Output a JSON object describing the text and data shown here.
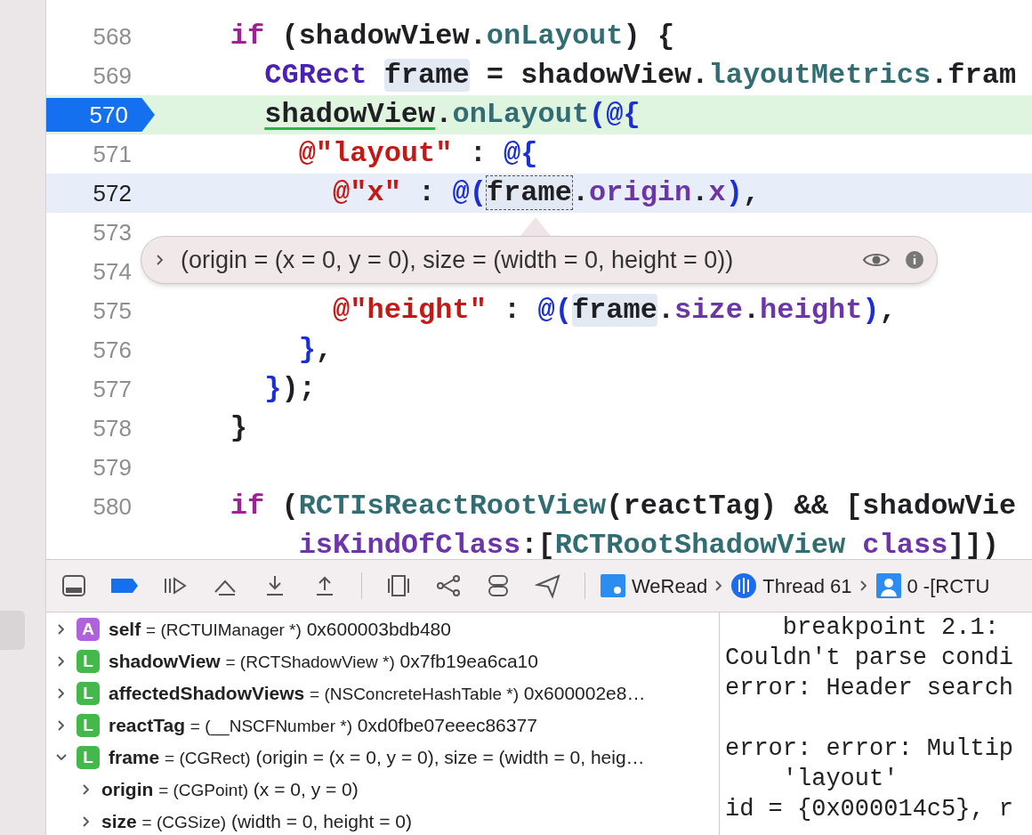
{
  "editor": {
    "lines": [
      {
        "number": "568",
        "kind": "plain",
        "tokens": [
          {
            "text": "    if",
            "kind": "keyword"
          },
          {
            "text": " (shadowView.",
            "kind": "plain"
          },
          {
            "text": "onLayout",
            "kind": "property"
          },
          {
            "text": ") {",
            "kind": "plain"
          }
        ]
      },
      {
        "number": "569",
        "kind": "plain",
        "tokens": [
          {
            "text": "      CGRect ",
            "kind": "type"
          },
          {
            "text": "frame",
            "kind": "reference"
          },
          {
            "text": " = shadowView.",
            "kind": "plain"
          },
          {
            "text": "layoutMetrics",
            "kind": "property"
          },
          {
            "text": ".fram",
            "kind": "plain"
          }
        ]
      },
      {
        "number": "570",
        "kind": "breakpoint",
        "tokens": [
          {
            "text": "      shadowView",
            "kind": "underline"
          },
          {
            "text": ".",
            "kind": "plain"
          },
          {
            "text": "onLayout",
            "kind": "property"
          },
          {
            "text": "(@{",
            "kind": "literal"
          }
        ]
      },
      {
        "number": "571",
        "kind": "plain",
        "tokens": [
          {
            "text": "        @\"layout\"",
            "kind": "string"
          },
          {
            "text": " : ",
            "kind": "plain"
          },
          {
            "text": "@{",
            "kind": "literal"
          }
        ]
      },
      {
        "number": "572",
        "kind": "cursor",
        "tokens": [
          {
            "text": "          @\"x\"",
            "kind": "string"
          },
          {
            "text": " : ",
            "kind": "plain"
          },
          {
            "text": "@(",
            "kind": "literal"
          },
          {
            "text": "frame",
            "kind": "hovered"
          },
          {
            "text": ".",
            "kind": "plain"
          },
          {
            "text": "origin",
            "kind": "method"
          },
          {
            "text": ".",
            "kind": "plain"
          },
          {
            "text": "x",
            "kind": "method"
          },
          {
            "text": ")",
            "kind": "literal"
          },
          {
            "text": ",",
            "kind": "plain"
          }
        ]
      },
      {
        "number": "573",
        "kind": "plain"
      },
      {
        "number": "574",
        "kind": "plain"
      },
      {
        "number": "575",
        "kind": "plain",
        "tokens": [
          {
            "text": "          @\"height\"",
            "kind": "string"
          },
          {
            "text": " : ",
            "kind": "plain"
          },
          {
            "text": "@(",
            "kind": "literal"
          },
          {
            "text": "frame",
            "kind": "reference"
          },
          {
            "text": ".",
            "kind": "plain"
          },
          {
            "text": "size",
            "kind": "method"
          },
          {
            "text": ".",
            "kind": "plain"
          },
          {
            "text": "height",
            "kind": "method"
          },
          {
            "text": ")",
            "kind": "literal"
          },
          {
            "text": ",",
            "kind": "plain"
          }
        ]
      },
      {
        "number": "576",
        "kind": "plain",
        "tokens": [
          {
            "text": "        }",
            "kind": "literal"
          },
          {
            "text": ",",
            "kind": "plain"
          }
        ]
      },
      {
        "number": "577",
        "kind": "plain",
        "tokens": [
          {
            "text": "      }",
            "kind": "literal"
          },
          {
            "text": ");",
            "kind": "plain"
          }
        ]
      },
      {
        "number": "578",
        "kind": "plain",
        "tokens": [
          {
            "text": "    }",
            "kind": "plain"
          }
        ]
      },
      {
        "number": "579",
        "kind": "plain"
      },
      {
        "number": "580",
        "kind": "plain",
        "tokens": [
          {
            "text": "    if",
            "kind": "keyword"
          },
          {
            "text": " (",
            "kind": "plain"
          },
          {
            "text": "RCTIsReactRootView",
            "kind": "property"
          },
          {
            "text": "(reactTag) && [shadowVie",
            "kind": "plain"
          }
        ]
      },
      {
        "kind": "plain",
        "tokens": [
          {
            "text": "        isKindOfClass",
            "kind": "method"
          },
          {
            "text": ":[",
            "kind": "plain"
          },
          {
            "text": "RCTRootShadowView",
            "kind": "property"
          },
          {
            "text": " class",
            "kind": "method"
          },
          {
            "text": "]])",
            "kind": "plain"
          }
        ]
      }
    ],
    "popover": {
      "text": "(origin = (x = 0, y = 0), size = (width = 0, height = 0))"
    }
  },
  "debug_bar": {
    "breadcrumbs": [
      {
        "label": "WeRead",
        "kind": "app"
      },
      {
        "label": "Thread 61",
        "kind": "thread"
      },
      {
        "label": "0 -[RCTU",
        "kind": "frame"
      }
    ]
  },
  "variables": [
    {
      "badge": "A",
      "color": "#b062dc",
      "name": "self",
      "type": "= (RCTUIManager *)",
      "value": "0x600003bdb480",
      "expanded": false
    },
    {
      "badge": "L",
      "color": "#45b84b",
      "name": "shadowView",
      "type": "= (RCTShadowView *)",
      "value": "0x7fb19ea6ca10",
      "expanded": false
    },
    {
      "badge": "L",
      "color": "#45b84b",
      "name": "affectedShadowViews",
      "type": "= (NSConcreteHashTable *)",
      "value": "0x600002e8…",
      "expanded": false
    },
    {
      "badge": "L",
      "color": "#45b84b",
      "name": "reactTag",
      "type": "= (__NSCFNumber *)",
      "value": "0xd0fbe07eeec86377",
      "expanded": false
    },
    {
      "badge": "L",
      "color": "#45b84b",
      "name": "frame",
      "type": "= (CGRect)",
      "value": "(origin = (x = 0, y = 0), size = (width = 0, heig…",
      "expanded": true,
      "children": [
        {
          "name": "origin",
          "type": "= (CGPoint)",
          "value": "(x = 0, y = 0)",
          "expanded": false
        },
        {
          "name": "size",
          "type": "= (CGSize)",
          "value": "(width = 0, height = 0)",
          "expanded": false
        }
      ]
    }
  ],
  "console": {
    "blocks": [
      [
        "    breakpoint 2.1:",
        "Couldn't parse condi",
        "error: Header search"
      ],
      [
        "error: error: Multip",
        "    'layout'",
        "id = {0x000014c5}, r"
      ]
    ]
  }
}
